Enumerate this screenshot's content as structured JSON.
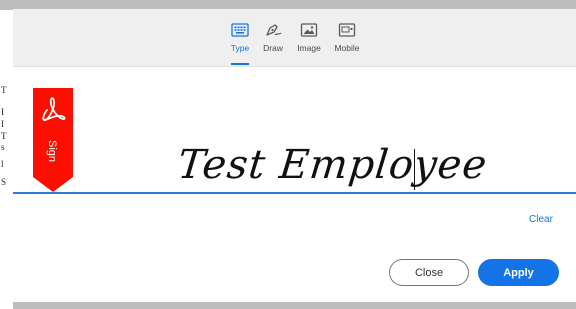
{
  "tabs": [
    {
      "label": "Type",
      "icon": "keyboard-icon",
      "active": true
    },
    {
      "label": "Draw",
      "icon": "pen-icon",
      "active": false
    },
    {
      "label": "Image",
      "icon": "image-icon",
      "active": false
    },
    {
      "label": "Mobile",
      "icon": "mobile-icon",
      "active": false
    }
  ],
  "sign_flag": {
    "label": "Sign",
    "icon": "acrobat-logo-icon",
    "color": "#fa0f00"
  },
  "signature": {
    "text": "Test Employee"
  },
  "clear_label": "Clear",
  "buttons": {
    "close_label": "Close",
    "apply_label": "Apply"
  },
  "background_document": {
    "edge_chars": [
      "T",
      "I",
      "I",
      "T",
      "s",
      "l",
      "S"
    ]
  },
  "colors": {
    "accent": "#1473e6",
    "baseline": "#2e7bcf"
  }
}
